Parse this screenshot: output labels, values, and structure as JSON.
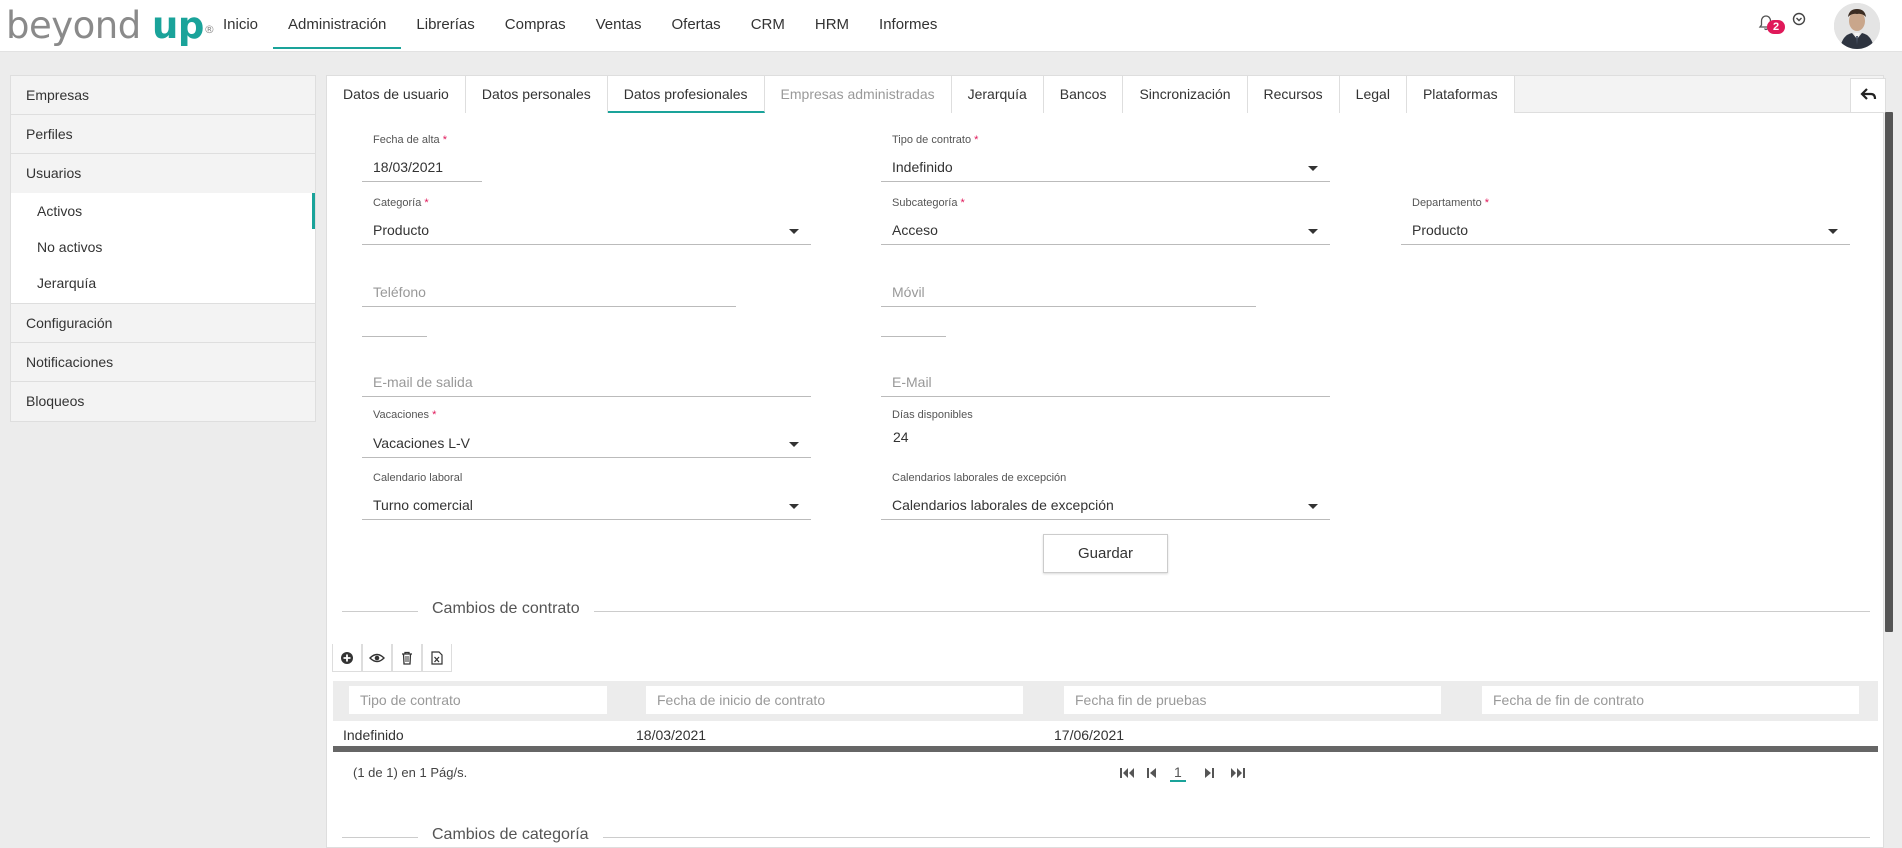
{
  "header": {
    "logo_part1": "beyond ",
    "logo_part2": "up",
    "logo_mark": "®",
    "nav": [
      "Inicio",
      "Administración",
      "Librerías",
      "Compras",
      "Ventas",
      "Ofertas",
      "CRM",
      "HRM",
      "Informes"
    ],
    "nav_active": "Administración",
    "notifications_count": "2"
  },
  "sidebar": {
    "items": [
      {
        "label": "Empresas"
      },
      {
        "label": "Perfiles"
      },
      {
        "label": "Usuarios"
      }
    ],
    "subitems": [
      {
        "label": "Activos"
      },
      {
        "label": "No activos"
      },
      {
        "label": "Jerarquía"
      }
    ],
    "items_after": [
      {
        "label": "Configuración"
      },
      {
        "label": "Notificaciones"
      },
      {
        "label": "Bloqueos"
      }
    ]
  },
  "tabs": [
    {
      "label": "Datos de usuario"
    },
    {
      "label": "Datos personales"
    },
    {
      "label": "Datos profesionales"
    },
    {
      "label": "Empresas administradas"
    },
    {
      "label": "Jerarquía"
    },
    {
      "label": "Bancos"
    },
    {
      "label": "Sincronización"
    },
    {
      "label": "Recursos"
    },
    {
      "label": "Legal"
    },
    {
      "label": "Plataformas"
    }
  ],
  "form": {
    "fecha_alta_label": "Fecha de alta",
    "fecha_alta_value": "18/03/2021",
    "tipo_contrato_label": "Tipo de contrato",
    "tipo_contrato_value": "Indefinido",
    "categoria_label": "Categoría",
    "categoria_value": "Producto",
    "subcategoria_label": "Subcategoría",
    "subcategoria_value": "Acceso",
    "departamento_label": "Departamento",
    "departamento_value": "Producto",
    "telefono_placeholder": "Teléfono",
    "movil_placeholder": "Móvil",
    "email_salida_placeholder": "E-mail de salida",
    "email_placeholder": "E-Mail",
    "vacaciones_label": "Vacaciones",
    "vacaciones_value": "Vacaciones L-V",
    "dias_disponibles_label": "Días disponibles",
    "dias_disponibles_value": "24",
    "calendario_label": "Calendario laboral",
    "calendario_value": "Turno comercial",
    "calendarios_excepcion_label": "Calendarios laborales de excepción",
    "calendarios_excepcion_value": "Calendarios laborales de excepción",
    "required_mark": "*",
    "save_label": "Guardar"
  },
  "contract_changes": {
    "title": "Cambios de contrato",
    "filters": [
      "Tipo de contrato",
      "Fecha de inicio de contrato",
      "Fecha fin de pruebas",
      "Fecha de fin de contrato"
    ],
    "rows": [
      {
        "tipo": "Indefinido",
        "inicio": "18/03/2021",
        "fin_pruebas": "17/06/2021",
        "fin": ""
      }
    ],
    "pager_text": "(1 de 1) en 1 Pág/s.",
    "page": "1"
  },
  "category_changes": {
    "title": "Cambios de categoría"
  },
  "colors": {
    "accent": "#1aa39a",
    "badge": "#e0195a",
    "required": "#e0195a"
  }
}
